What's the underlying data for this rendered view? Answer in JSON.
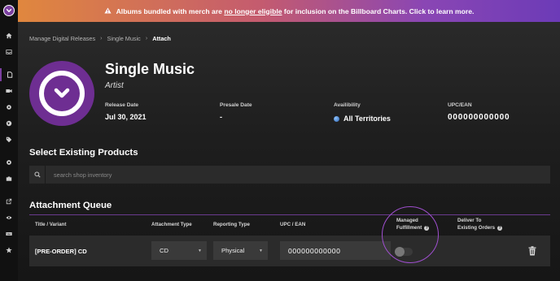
{
  "banner": {
    "prefix": "Albums bundled with merch are",
    "link": "no longer eligible",
    "suffix": "for inclusion on the Billboard Charts. Click to learn more."
  },
  "breadcrumb": {
    "items": [
      "Manage Digital Releases",
      "Single Music"
    ],
    "current": "Attach"
  },
  "release": {
    "title": "Single Music",
    "artist": "Artist",
    "release_date_label": "Release Date",
    "release_date": "Jul 30, 2021",
    "presale_label": "Presale Date",
    "presale": "-",
    "availability_label": "Availibility",
    "availability": "All Territories",
    "upc_label": "UPC/EAN",
    "upc": "000000000000"
  },
  "select_products": {
    "heading": "Select Existing Products",
    "search_placeholder": "search shop inventory"
  },
  "queue": {
    "heading": "Attachment Queue",
    "columns": {
      "title": "Title / Variant",
      "attachment_type": "Attachment Type",
      "reporting_type": "Reporting Type",
      "upc": "UPC / EAN",
      "managed_line1": "Managed",
      "managed_line2": "Fulfillment",
      "deliver_line1": "Deliver To",
      "deliver_line2": "Existing Orders"
    },
    "row": {
      "title": "[PRE-ORDER] CD",
      "attachment_type": "CD",
      "reporting_type": "Physical",
      "upc": "000000000000",
      "managed_fulfillment": false
    }
  },
  "colors": {
    "accent": "#7b3fa0",
    "banner_start": "#e0873e",
    "banner_end": "#6c3bb7"
  }
}
